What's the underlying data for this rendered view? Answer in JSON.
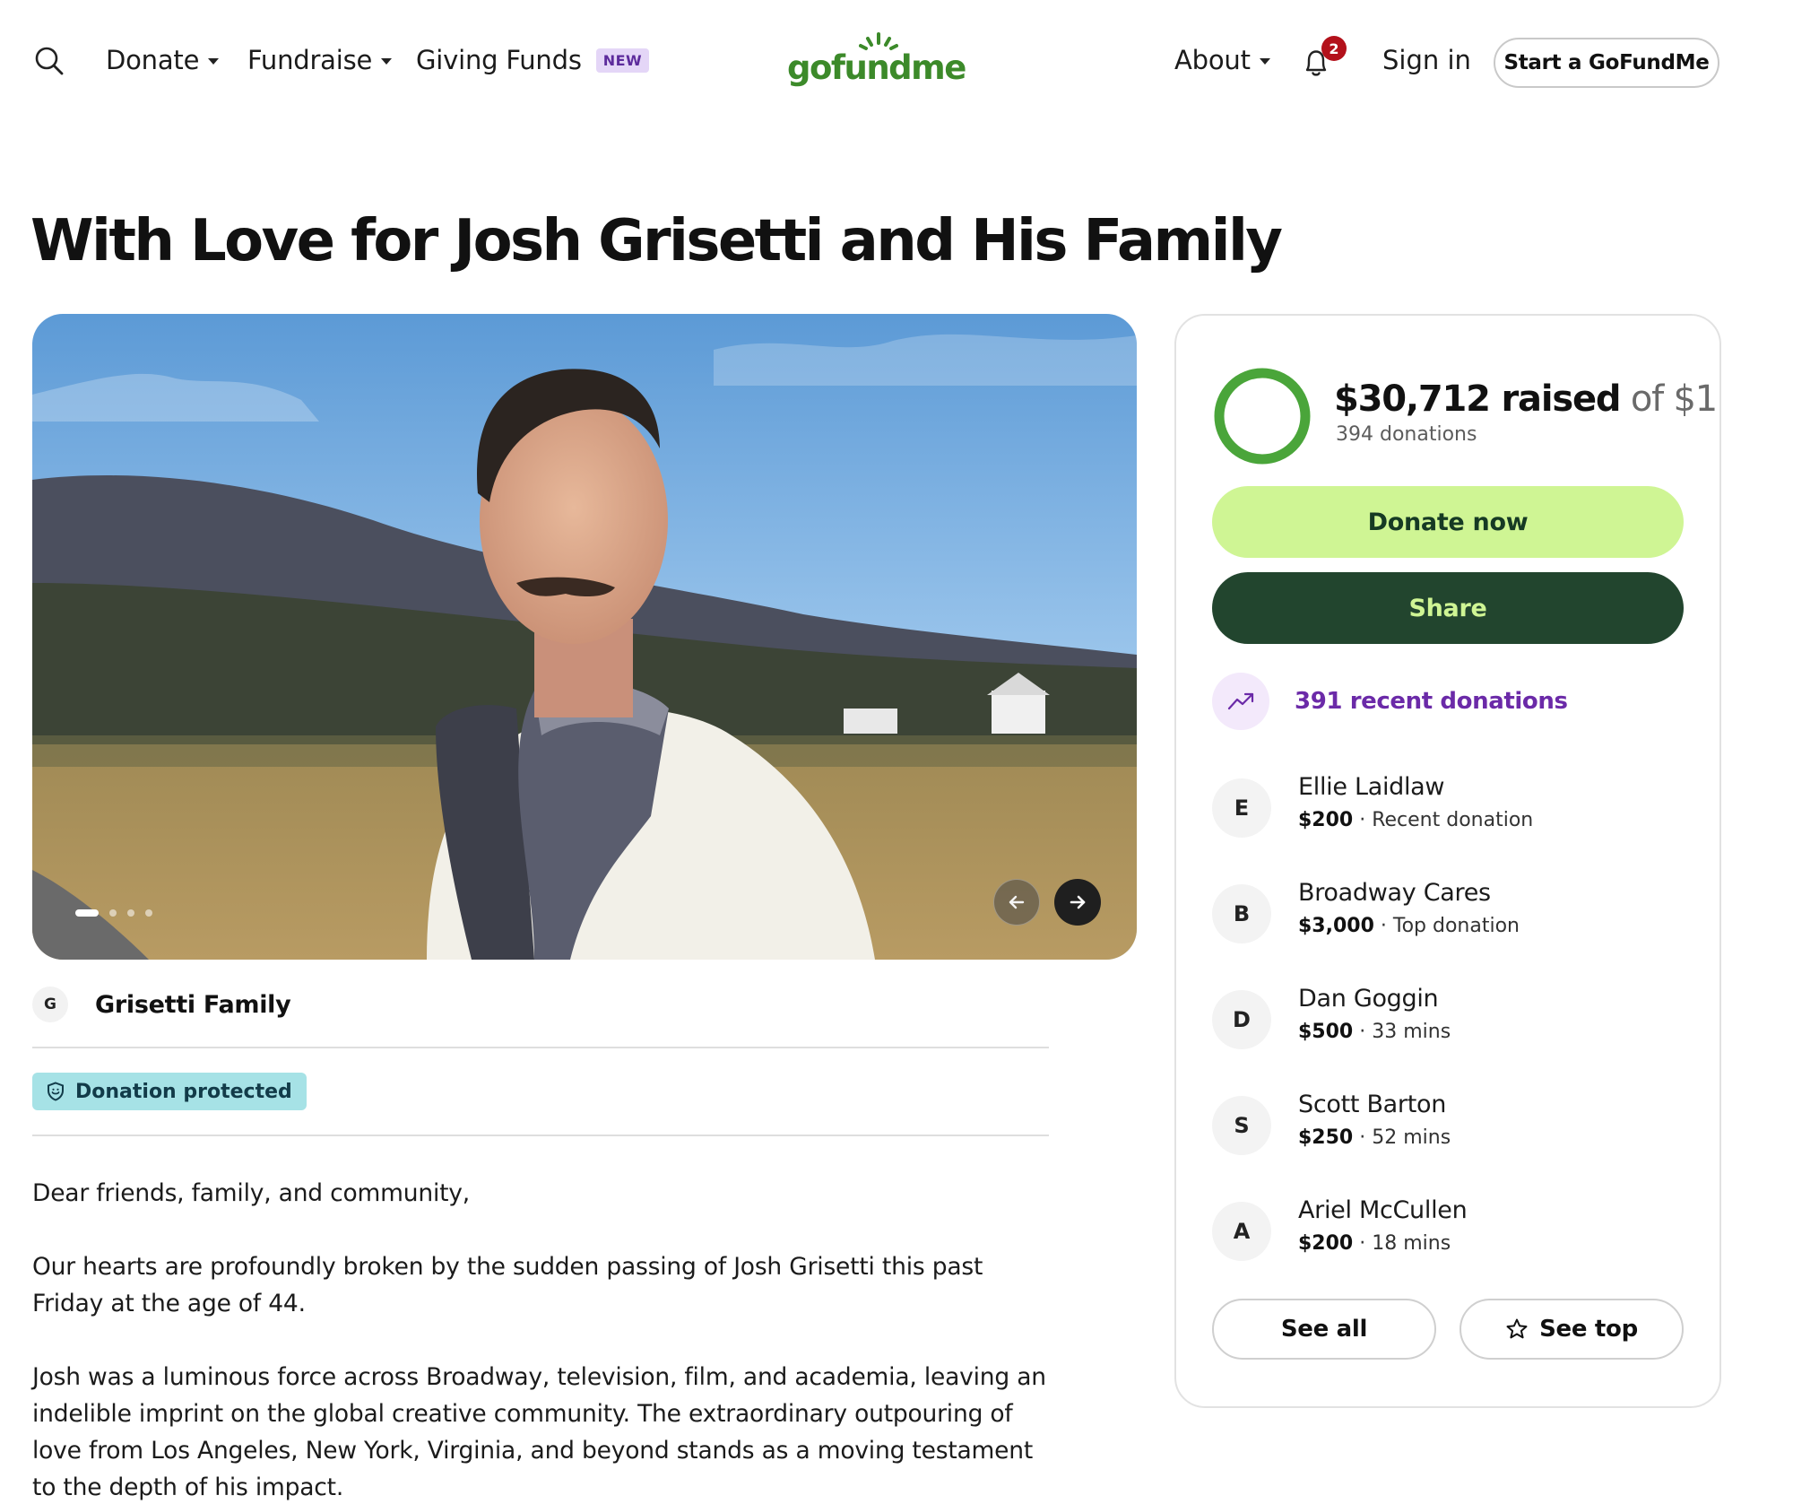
{
  "header": {
    "nav": {
      "donate": "Donate",
      "fundraise": "Fundraise",
      "giving_funds": "Giving Funds",
      "new_badge": "NEW"
    },
    "logo_text": "gofundme",
    "about": "About",
    "notification_count": "2",
    "sign_in": "Sign in",
    "start_button": "Start a GoFundMe"
  },
  "campaign": {
    "title": "With Love for Josh Grisetti and His Family",
    "carousel": {
      "slides": 4,
      "active_slide": 1
    },
    "organizer": {
      "initial": "G",
      "name": "Grisetti Family"
    },
    "protected_badge": "Donation protected",
    "story": [
      "Dear friends, family, and community,",
      "Our hearts are profoundly broken by the sudden passing of Josh Grisetti this past Friday at the age of 44.",
      "Josh was a luminous force across Broadway, television, film, and academia, leaving an indelible imprint on the global creative community. The extraordinary outpouring of love from Los Angeles, New York, Virginia, and beyond stands as a moving testament to the depth of his impact."
    ]
  },
  "donation_card": {
    "raised_amount": "$30,712 raised",
    "goal": "of $1",
    "donation_count": "394 donations",
    "progress_fraction": 1.0,
    "donate_button": "Donate now",
    "share_button": "Share",
    "recent_donations_label": "391 recent donations",
    "donors": [
      {
        "initial": "E",
        "name": "Ellie Laidlaw",
        "amount": "$200",
        "detail": " · Recent donation"
      },
      {
        "initial": "B",
        "name": "Broadway Cares",
        "amount": "$3,000",
        "detail": " · Top donation"
      },
      {
        "initial": "D",
        "name": "Dan Goggin",
        "amount": "$500",
        "detail": " · 33 mins"
      },
      {
        "initial": "S",
        "name": "Scott Barton",
        "amount": "$250",
        "detail": " · 52 mins"
      },
      {
        "initial": "A",
        "name": "Ariel McCullen",
        "amount": "$200",
        "detail": " · 18 mins"
      }
    ],
    "see_all": "See all",
    "see_top": "See top"
  },
  "colors": {
    "brand_green": "#3c8a2a",
    "donate_button_bg": "#cff594",
    "share_button_bg": "#22452e",
    "recent_label": "#6b2aa8",
    "protected_badge_bg": "#a6e2e6",
    "notification_badge": "#b3111b"
  }
}
